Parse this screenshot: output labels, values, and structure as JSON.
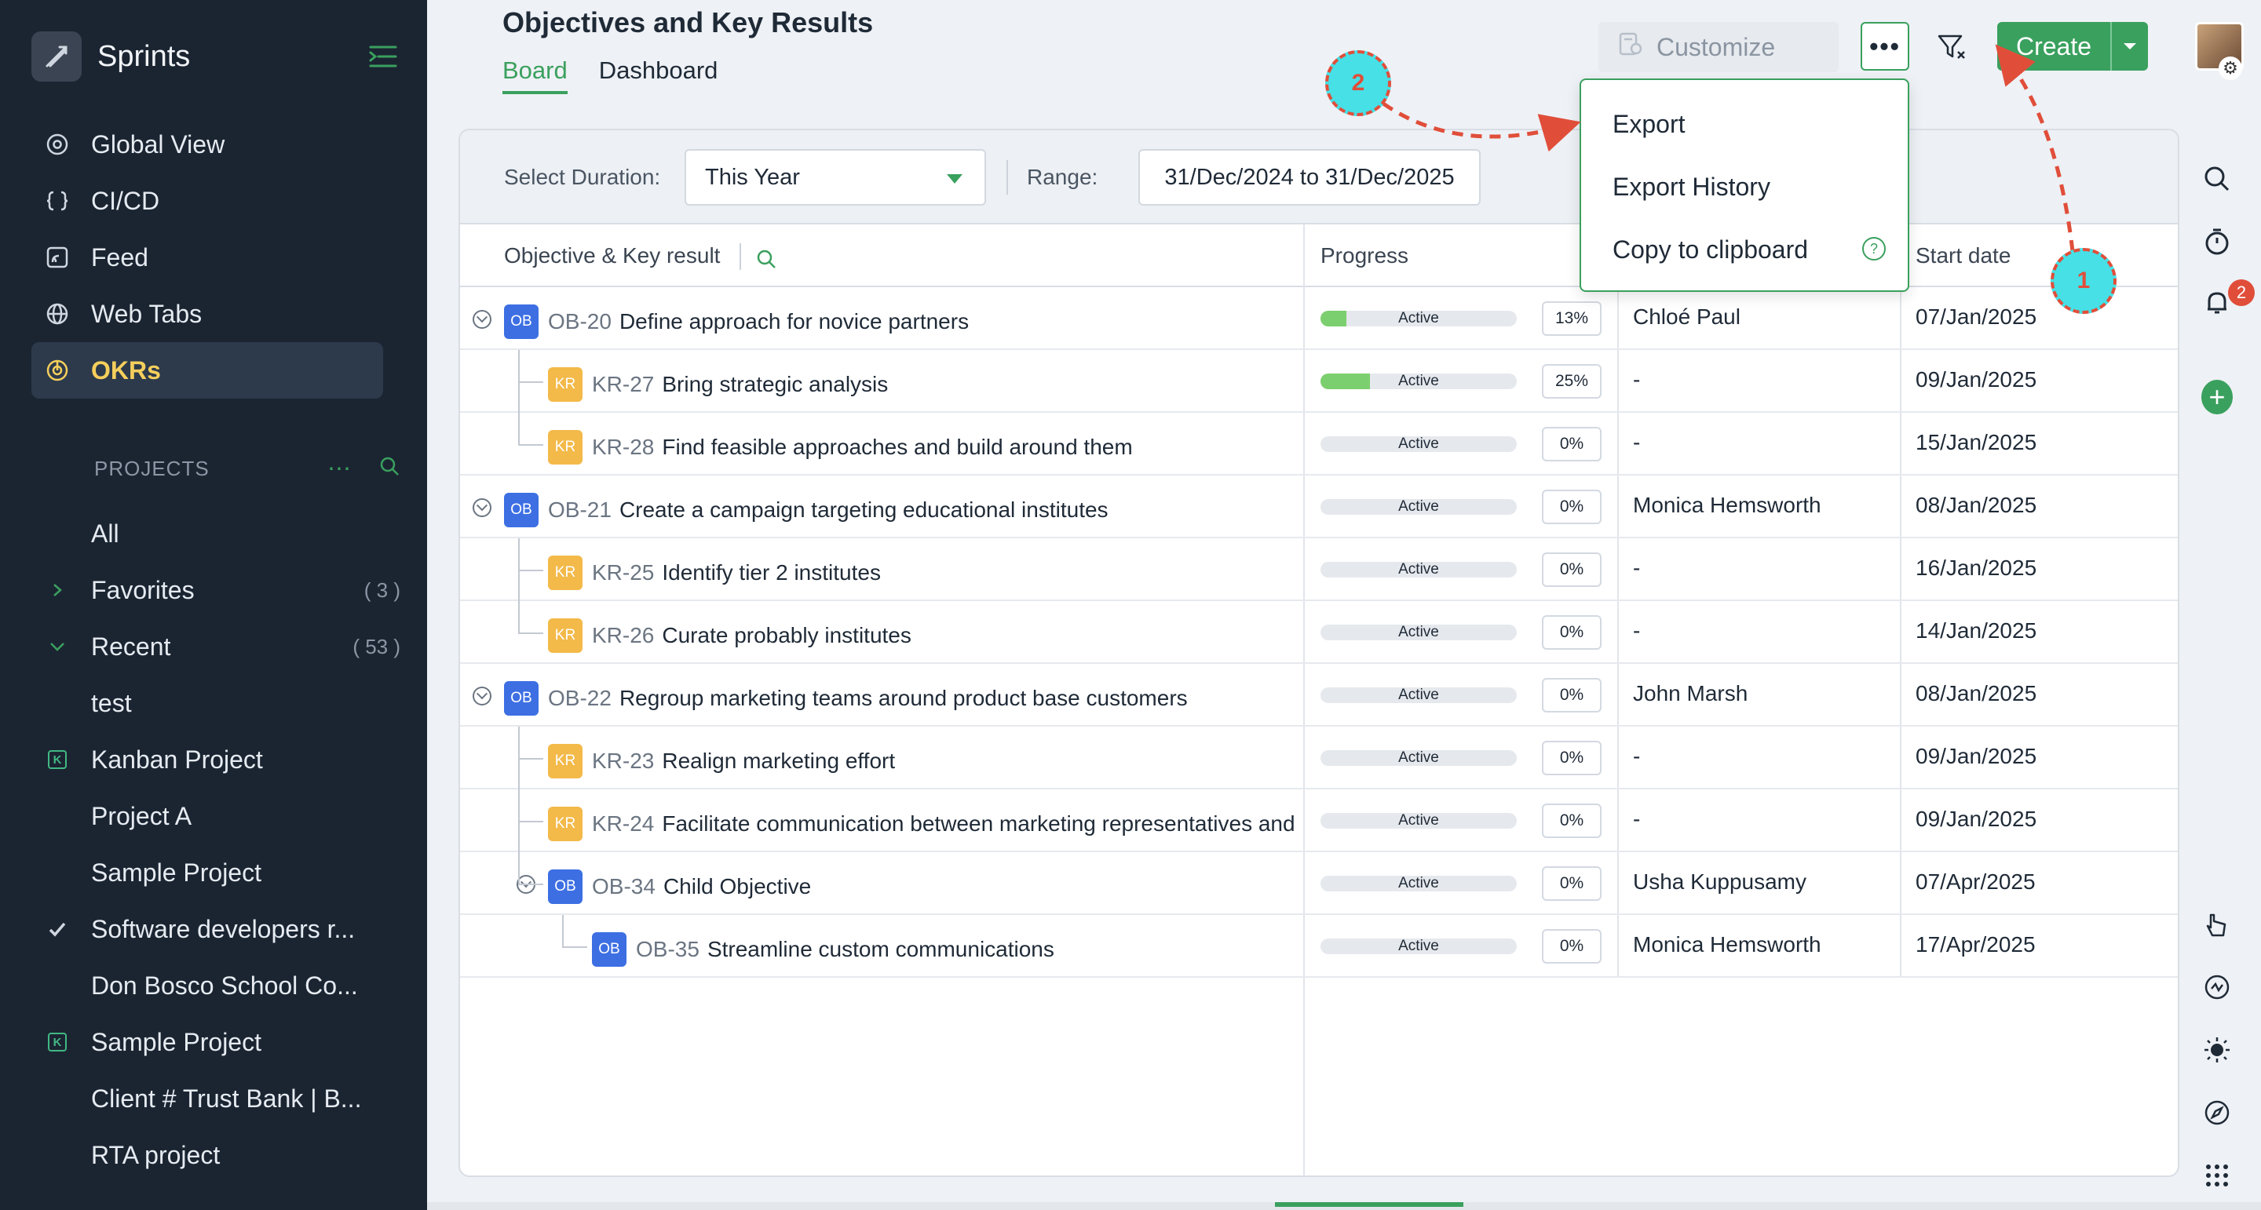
{
  "app": {
    "name": "Sprints"
  },
  "sidebar": {
    "nav": [
      {
        "label": "Global View",
        "icon": "globe-eye-icon"
      },
      {
        "label": "CI/CD",
        "icon": "code-braces-icon"
      },
      {
        "label": "Feed",
        "icon": "feed-icon"
      },
      {
        "label": "Web Tabs",
        "icon": "web-globe-icon"
      },
      {
        "label": "OKRs",
        "icon": "target-icon",
        "active": true
      }
    ],
    "projects_heading": "PROJECTS",
    "projects": [
      {
        "label": "All"
      },
      {
        "label": "Favorites",
        "count": "( 3 )",
        "icon": "chevron-right-icon"
      },
      {
        "label": "Recent",
        "count": "( 53 )",
        "icon": "chevron-down-icon"
      },
      {
        "label": "test"
      },
      {
        "label": "Kanban Project",
        "icon": "kanban-icon"
      },
      {
        "label": "Project A"
      },
      {
        "label": "Sample Project"
      },
      {
        "label": "Software developers r...",
        "icon": "check-icon"
      },
      {
        "label": "Don Bosco School Co..."
      },
      {
        "label": "Sample Project",
        "icon": "kanban-icon"
      },
      {
        "label": "Client # Trust Bank | B..."
      },
      {
        "label": "RTA project"
      }
    ]
  },
  "header": {
    "title": "Objectives and Key Results",
    "tabs": [
      {
        "label": "Board",
        "active": true
      },
      {
        "label": "Dashboard"
      }
    ],
    "customize_label": "Customize",
    "more_label": "•••",
    "create_label": "Create"
  },
  "filters": {
    "duration_label": "Select Duration:",
    "duration_value": "This Year",
    "range_label": "Range:",
    "range_value": "31/Dec/2024 to 31/Dec/2025"
  },
  "table": {
    "columns": {
      "objective": "Objective & Key result",
      "progress": "Progress",
      "start_date": "Start date"
    },
    "rows": [
      {
        "type": "OB",
        "code": "OB-20",
        "title": "Define approach for novice partners",
        "status": "Active",
        "progress": 13,
        "pct": "13%",
        "owner": "Chloé Paul",
        "start": "07/Jan/2025"
      },
      {
        "type": "KR",
        "code": "KR-27",
        "title": "Bring strategic analysis",
        "status": "Active",
        "progress": 25,
        "pct": "25%",
        "owner": "-",
        "start": "09/Jan/2025"
      },
      {
        "type": "KR",
        "code": "KR-28",
        "title": "Find feasible approaches and build around them",
        "status": "Active",
        "progress": 0,
        "pct": "0%",
        "owner": "-",
        "start": "15/Jan/2025"
      },
      {
        "type": "OB",
        "code": "OB-21",
        "title": "Create a campaign targeting educational institutes",
        "status": "Active",
        "progress": 0,
        "pct": "0%",
        "owner": "Monica Hemsworth",
        "start": "08/Jan/2025"
      },
      {
        "type": "KR",
        "code": "KR-25",
        "title": "Identify tier 2 institutes",
        "status": "Active",
        "progress": 0,
        "pct": "0%",
        "owner": "-",
        "start": "16/Jan/2025"
      },
      {
        "type": "KR",
        "code": "KR-26",
        "title": "Curate probably institutes",
        "status": "Active",
        "progress": 0,
        "pct": "0%",
        "owner": "-",
        "start": "14/Jan/2025"
      },
      {
        "type": "OB",
        "code": "OB-22",
        "title": "Regroup marketing teams around product base customers",
        "status": "Active",
        "progress": 0,
        "pct": "0%",
        "owner": "John Marsh",
        "start": "08/Jan/2025"
      },
      {
        "type": "KR",
        "code": "KR-23",
        "title": "Realign marketing effort",
        "status": "Active",
        "progress": 0,
        "pct": "0%",
        "owner": "-",
        "start": "09/Jan/2025"
      },
      {
        "type": "KR",
        "code": "KR-24",
        "title": "Facilitate communication between marketing representatives and p",
        "status": "Active",
        "progress": 0,
        "pct": "0%",
        "owner": "-",
        "start": "09/Jan/2025"
      },
      {
        "type": "OB",
        "code": "OB-34",
        "title": "Child Objective",
        "status": "Active",
        "progress": 0,
        "pct": "0%",
        "owner": "Usha Kuppusamy",
        "start": "07/Apr/2025"
      },
      {
        "type": "OB",
        "code": "OB-35",
        "title": "Streamline custom communications",
        "status": "Active",
        "progress": 0,
        "pct": "0%",
        "owner": "Monica Hemsworth",
        "start": "17/Apr/2025"
      }
    ]
  },
  "menu": {
    "items": [
      {
        "label": "Export"
      },
      {
        "label": "Export History"
      },
      {
        "label": "Copy to clipboard"
      }
    ],
    "help_glyph": "?"
  },
  "notifications": {
    "count": "2"
  },
  "annotations": [
    {
      "label": "1"
    },
    {
      "label": "2"
    }
  ],
  "colors": {
    "accent": "#3aa05e",
    "sidebar_bg": "#1b2532",
    "objective_tag": "#3d6fe3",
    "key_result_tag": "#f3b949",
    "callout_fill": "#46e0e6",
    "callout_stroke": "#e04e3a"
  }
}
